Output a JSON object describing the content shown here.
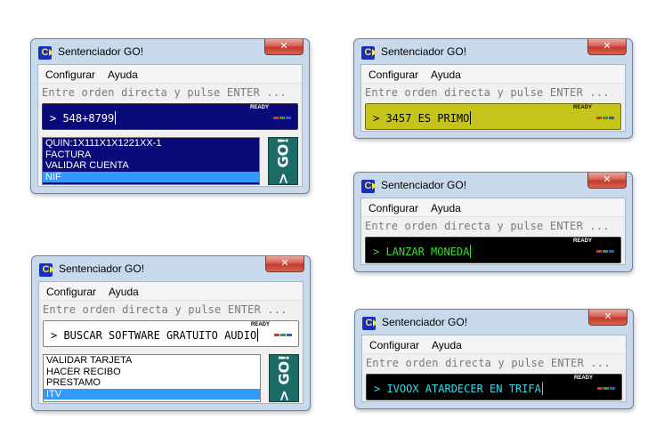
{
  "windows": [
    {
      "title": "Sentenciador  GO!",
      "close_label": "✕",
      "menu": [
        "Configurar",
        "Ayuda"
      ],
      "hint": "Entre orden directa y pulse ENTER ...",
      "command": "> 548+8799",
      "ready": "READY",
      "colors": {
        "cmd_bg": "#0a0a78",
        "cmd_text": "#ffffff",
        "ready_text": "#ffffff"
      },
      "list_items": [
        "QUIN:1X111X1X1221XX-1",
        "FACTURA",
        "VALIDAR CUENTA",
        "NIF"
      ],
      "list_colors": {
        "bg": "#0a0a78",
        "text": "#ffffff",
        "selected_bg": "#3399ff"
      },
      "go_label": "> GO!"
    },
    {
      "title": "Sentenciador  GO!",
      "close_label": "✕",
      "menu": [
        "Configurar",
        "Ayuda"
      ],
      "hint": "Entre orden directa y pulse ENTER ...",
      "command": "> 3457 ES PRIMO",
      "ready": "READY",
      "colors": {
        "cmd_bg": "#c4c41a",
        "cmd_text": "#000000",
        "ready_text": "#000000"
      }
    },
    {
      "title": "Sentenciador  GO!",
      "close_label": "✕",
      "menu": [
        "Configurar",
        "Ayuda"
      ],
      "hint": "Entre orden directa y pulse ENTER ...",
      "command": "> LANZAR MONEDA",
      "ready": "READY",
      "colors": {
        "cmd_bg": "#000000",
        "cmd_text": "#3ddc2f",
        "ready_text": "#ffffff"
      }
    },
    {
      "title": "Sentenciador  GO!",
      "close_label": "✕",
      "menu": [
        "Configurar",
        "Ayuda"
      ],
      "hint": "Entre orden directa y pulse ENTER ...",
      "command": "> BUSCAR SOFTWARE GRATUITO AUDIO",
      "ready": "READY",
      "colors": {
        "cmd_bg": "#ffffff",
        "cmd_text": "#000000",
        "ready_text": "#000000"
      },
      "list_items": [
        "VALIDAR TARJETA",
        "HACER RECIBO",
        "PRESTAMO",
        "ITV"
      ],
      "list_colors": {
        "bg": "#ffffff",
        "text": "#000000",
        "selected_bg": "#3399ff"
      },
      "go_label": "> GO!"
    },
    {
      "title": "Sentenciador  GO!",
      "close_label": "✕",
      "menu": [
        "Configurar",
        "Ayuda"
      ],
      "hint": "Entre orden directa y pulse ENTER ...",
      "command": "> IVOOX ATARDECER EN TRIFA",
      "ready": "READY",
      "colors": {
        "cmd_bg": "#000000",
        "cmd_text": "#3ad8e6",
        "ready_text": "#ffffff"
      }
    }
  ],
  "led_colors": [
    "#e03030",
    "#2e9e2e",
    "#2b58d8"
  ]
}
